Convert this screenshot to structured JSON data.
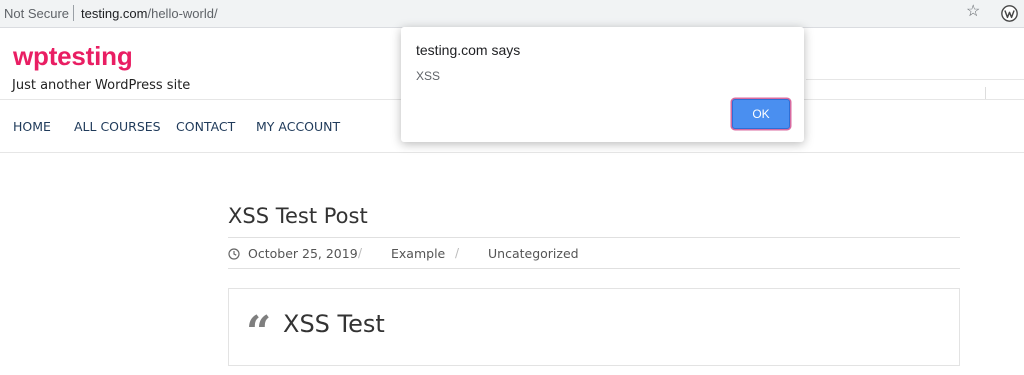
{
  "browser": {
    "security_label": "Not Secure",
    "url_host": "testing.com",
    "url_path": "/hello-world/",
    "icons": [
      "star-icon",
      "wordpress-icon"
    ]
  },
  "site": {
    "title": "wptesting",
    "tagline": "Just another WordPress site",
    "brand_color": "#e91e63"
  },
  "nav": {
    "items": [
      "HOME",
      "ALL COURSES",
      "CONTACT",
      "MY ACCOUNT"
    ]
  },
  "post": {
    "title": "XSS Test Post",
    "date": "October 25, 2019",
    "meta_separator": "/",
    "tag": "Example",
    "category": "Uncategorized",
    "quote_text": "XSS Test",
    "quote_glyph": "“"
  },
  "alert": {
    "title": "testing.com says",
    "message": "XSS",
    "ok_label": "OK",
    "accent_color": "#4a8ff0"
  }
}
